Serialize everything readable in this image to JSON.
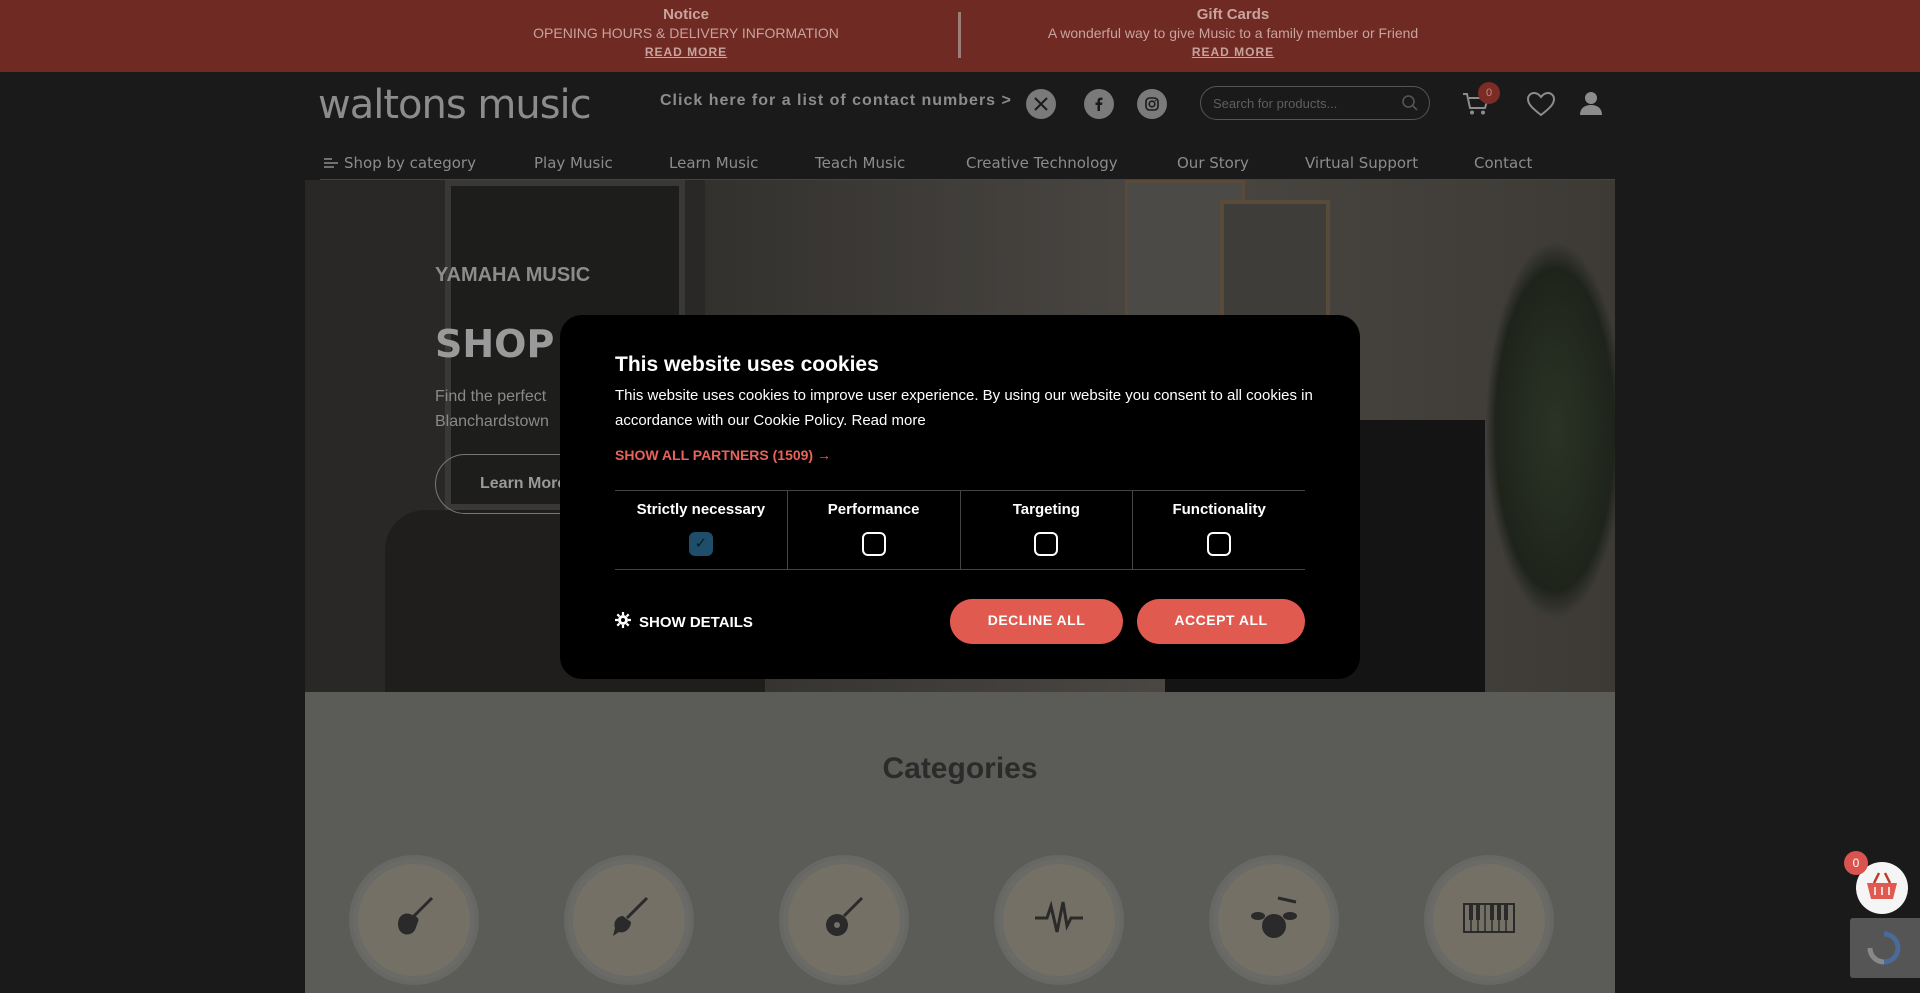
{
  "notice": {
    "left": {
      "title": "Notice",
      "subtitle": "OPENING HOURS & DELIVERY INFORMATION",
      "link": "READ MORE"
    },
    "right": {
      "title": "Gift Cards",
      "subtitle": "A wonderful way to give Music to a family member or Friend",
      "link": "READ MORE"
    }
  },
  "header": {
    "logo": "waltons music",
    "contact_link": "Click here for a list of contact numbers >",
    "search_placeholder": "Search for products...",
    "cart_count": "0",
    "social": [
      "x-icon",
      "facebook-icon",
      "instagram-icon"
    ]
  },
  "nav": {
    "items": [
      "Shop by category",
      "Play Music",
      "Learn Music",
      "Teach Music",
      "Creative Technology",
      "Our Story",
      "Virtual Support",
      "Contact"
    ]
  },
  "hero": {
    "brand": "YAMAHA MUSIC",
    "title": "SHOP",
    "text": "Find the perfect Blanchardstown",
    "button": "Learn More"
  },
  "categories": {
    "title": "Categories",
    "icons": [
      "electric-guitar-icon",
      "bass-guitar-icon",
      "acoustic-guitar-icon",
      "audio-wave-icon",
      "drum-kit-icon",
      "keyboard-icon"
    ]
  },
  "cookie_modal": {
    "title": "This website uses cookies",
    "description": "This website uses cookies to improve user experience. By using our website you consent to all cookies in accordance with our Cookie Policy. Read more",
    "partners": "SHOW ALL PARTNERS (1509) →",
    "options": [
      {
        "label": "Strictly necessary",
        "checked": true
      },
      {
        "label": "Performance",
        "checked": false
      },
      {
        "label": "Targeting",
        "checked": false
      },
      {
        "label": "Functionality",
        "checked": false
      }
    ],
    "show_details": "SHOW DETAILS",
    "decline": "DECLINE ALL",
    "accept": "ACCEPT ALL"
  },
  "floating_cart": {
    "count": "0"
  },
  "colors": {
    "accent": "#e05a50",
    "notice_bg": "#6f2a24",
    "overlay": "#1a1a1a"
  }
}
